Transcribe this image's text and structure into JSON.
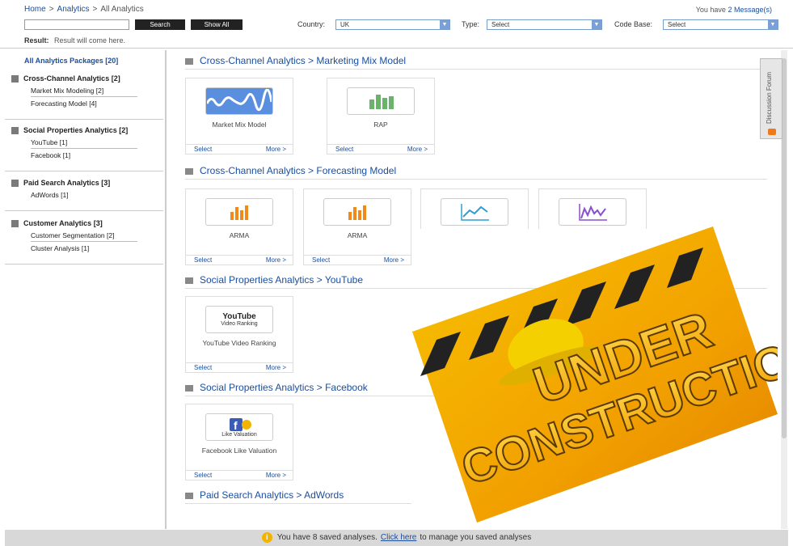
{
  "breadcrumb": {
    "home": "Home",
    "analytics": "Analytics",
    "current": "All Analytics"
  },
  "messages": {
    "prefix": "You have",
    "link": "2 Message(s)"
  },
  "search": {
    "placeholder": "",
    "search_label": "Search",
    "show_all_label": "Show All"
  },
  "filters": {
    "country_label": "Country:",
    "country_value": "UK",
    "type_label": "Type:",
    "type_value": "Select",
    "codebase_label": "Code Base:",
    "codebase_value": "Select"
  },
  "result": {
    "label": "Result:",
    "text": "Result will come here."
  },
  "sidebar": {
    "all": "All Analytics Packages [20]",
    "groups": [
      {
        "title": "Cross-Channel Analytics [2]",
        "items": [
          "Market Mix Modeling [2]",
          "Forecasting Model [4]"
        ]
      },
      {
        "title": "Social Properties Analytics [2]",
        "items": [
          "YouTube [1]",
          "Facebook [1]"
        ]
      },
      {
        "title": "Paid Search Analytics [3]",
        "items": [
          "AdWords [1]"
        ]
      },
      {
        "title": "Customer Analytics [3]",
        "items": [
          "Customer Segmentation [2]",
          "Cluster Analysis [1]"
        ]
      }
    ]
  },
  "sections": [
    {
      "title": "Cross-Channel Analytics > Marketing Mix Model",
      "cards": [
        {
          "name": "Market Mix Model",
          "icon": "wave-chart-icon"
        },
        {
          "name": "RAP",
          "icon": "green-bar-chart-icon"
        }
      ]
    },
    {
      "title": "Cross-Channel Analytics > Forecasting Model",
      "cards": [
        {
          "name": "ARMA",
          "icon": "orange-bar-chart-icon"
        },
        {
          "name": "ARMA",
          "icon": "orange-bar-chart-icon"
        },
        {
          "name": "",
          "icon": "blue-line-chart-icon"
        },
        {
          "name": "",
          "icon": "purple-area-chart-icon"
        }
      ]
    },
    {
      "title": "Social Properties Analytics > YouTube",
      "cards": [
        {
          "name": "YouTube Video Ranking",
          "icon": "youtube-icon",
          "icon_text": "Video Ranking",
          "logo": "YouTube"
        }
      ]
    },
    {
      "title": "Social Properties Analytics > Facebook",
      "cards": [
        {
          "name": "Facebook Like Valuation",
          "icon": "facebook-icon",
          "icon_text": "Like Valuation"
        }
      ]
    },
    {
      "title": "Paid Search Analytics > AdWords",
      "cards": []
    }
  ],
  "card_actions": {
    "select": "Select",
    "more": "More >"
  },
  "discussion_forum": "Discussion Forum",
  "footer": {
    "prefix": "You have 8 saved analyses.",
    "link": "Click here",
    "suffix": "to manage you saved analyses"
  },
  "banner": {
    "line1": "UNDER",
    "line2": "CONSTRUCTION"
  },
  "colors": {
    "link": "#1a4fa0",
    "construction_yellow": "#f2b000",
    "footer_bg": "#d8d8d8"
  }
}
